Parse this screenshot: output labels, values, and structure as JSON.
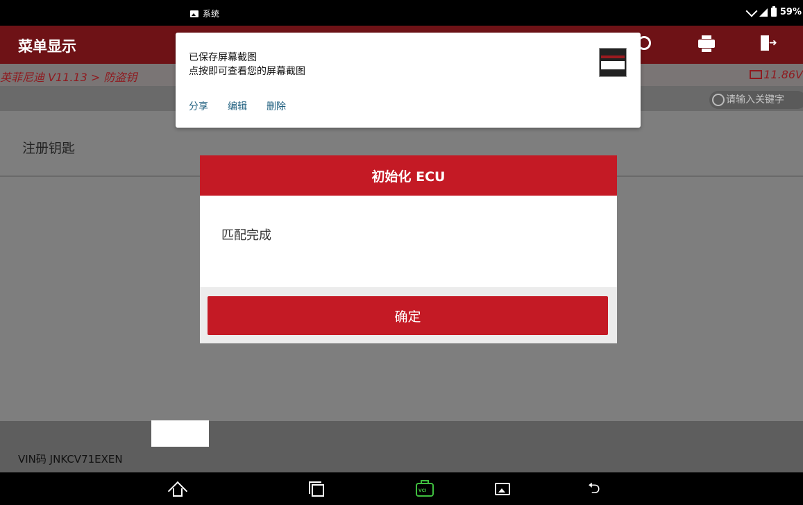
{
  "status_bar": {
    "app_label": "系统",
    "battery": "59%"
  },
  "app": {
    "title": "菜单显示",
    "breadcrumb": "英菲尼迪 V11.13 > 防盗钥",
    "voltage": "11.86V",
    "search_placeholder": "请输入关键字",
    "menu_item": "注册钥匙",
    "vin_label": "VIN码 JNKCV71EXEN"
  },
  "notification": {
    "title": "已保存屏幕截图",
    "subtitle": "点按即可查看您的屏幕截图",
    "actions": [
      "分享",
      "编辑",
      "删除"
    ]
  },
  "dialog": {
    "title": "初始化 ECU",
    "message": "匹配完成",
    "ok_label": "确定"
  },
  "colors": {
    "accent": "#c41a25",
    "titlebar_dimmed": "#6e1216",
    "vci_green": "#3fbf3f"
  }
}
